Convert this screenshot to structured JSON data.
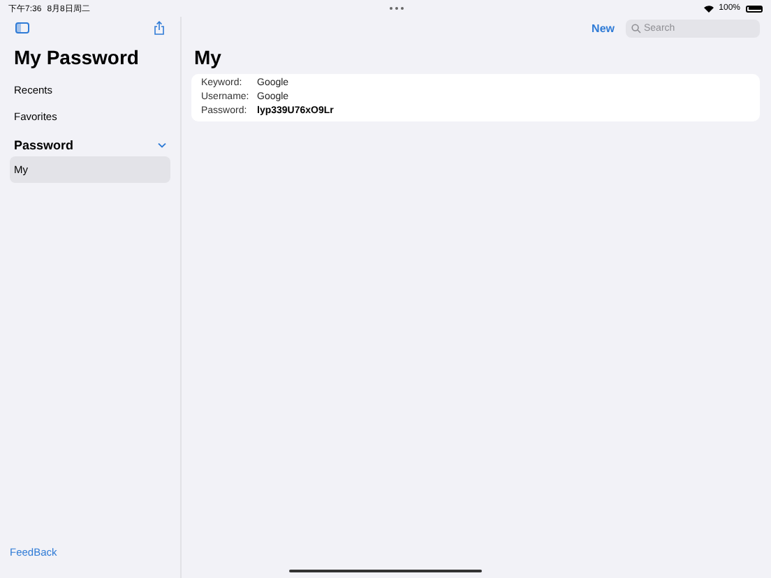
{
  "status_bar": {
    "time": "下午7:36",
    "date": "8月8日周二",
    "battery": "100%"
  },
  "sidebar": {
    "title": "My Password",
    "items": [
      {
        "label": "Recents",
        "selected": false
      },
      {
        "label": "Favorites",
        "selected": false
      }
    ],
    "section": {
      "title": "Password",
      "expanded": true,
      "items": [
        {
          "label": "My",
          "selected": true
        }
      ]
    },
    "footer_link": "FeedBack"
  },
  "toolbar": {
    "new_button": "New",
    "search": {
      "placeholder": "Search"
    }
  },
  "detail": {
    "title": "My",
    "fields": [
      {
        "label": "Keyword:",
        "value": "Google",
        "kind": "plain"
      },
      {
        "label": "Username:",
        "value": "Google",
        "kind": "plain"
      },
      {
        "label": "Password:",
        "value": "lyp339U76xO9Lr",
        "kind": "secret"
      }
    ]
  }
}
